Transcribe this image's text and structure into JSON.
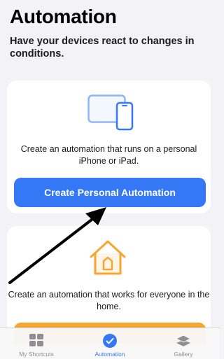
{
  "header": {
    "title": "Automation",
    "subtitle": "Have your devices react to changes in conditions."
  },
  "personal_card": {
    "icon": "iphone-ipad-icon",
    "description": "Create an automation that runs on a personal iPhone or iPad.",
    "button_label": "Create Personal Automation"
  },
  "home_card": {
    "icon": "home-icon",
    "description": "Create an automation that works for everyone in the home."
  },
  "tabbar": {
    "tabs": [
      {
        "label": "My Shortcuts",
        "icon": "grid-icon"
      },
      {
        "label": "Automation",
        "icon": "checkmark-clock-icon"
      },
      {
        "label": "Gallery",
        "icon": "layers-icon"
      }
    ],
    "active": "Automation"
  },
  "colors": {
    "accent": "#3478f6",
    "home_accent": "#f7a531",
    "background": "#f2f2f7"
  }
}
